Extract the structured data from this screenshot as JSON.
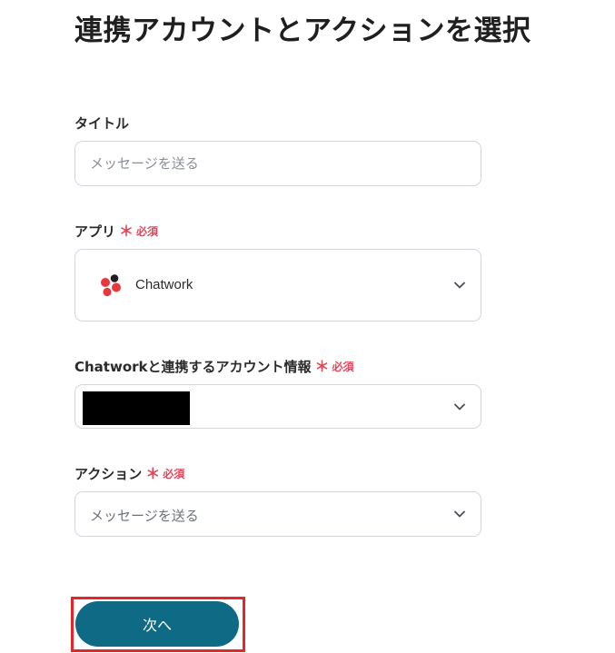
{
  "page": {
    "title": "連携アカウントとアクションを選択"
  },
  "fields": {
    "title_field": {
      "label": "タイトル",
      "value": "",
      "placeholder": "メッセージを送る"
    },
    "app_field": {
      "label": "アプリ",
      "required_mark": "＊",
      "required_label": "必須",
      "selected_app": "Chatwork",
      "app_icon": "chatwork-logo-icon"
    },
    "account_field": {
      "label": "Chatworkと連携するアカウント情報",
      "required_mark": "＊",
      "required_label": "必須",
      "selected_value_redacted": true
    },
    "action_field": {
      "label": "アクション",
      "required_mark": "＊",
      "required_label": "必須",
      "selected_action": "メッセージを送る"
    }
  },
  "buttons": {
    "next_label": "次へ"
  },
  "colors": {
    "primary_button": "#0e6a85",
    "required_accent": "#e0475a",
    "highlight_frame": "#e5252a",
    "chatwork_red": "#e8383d",
    "chatwork_dark": "#1e1e1e"
  },
  "icons": {
    "dropdown": "chevron-down-icon"
  }
}
